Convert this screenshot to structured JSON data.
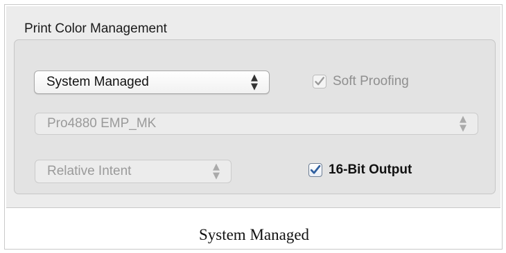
{
  "panel": {
    "title": "Print Color Management"
  },
  "controls": {
    "profile_mode_popup": {
      "selected": "System Managed",
      "icon": "updown-arrows-icon"
    },
    "soft_proofing": {
      "label": "Soft Proofing",
      "checked": true,
      "enabled": false,
      "icon": "checkmark-icon"
    },
    "printer_profile_popup": {
      "selected": "Pro4880 EMP_MK",
      "enabled": false,
      "icon": "updown-arrows-icon"
    },
    "rendering_intent_popup": {
      "selected": "Relative Intent",
      "enabled": false,
      "icon": "updown-arrows-icon"
    },
    "bit16_output": {
      "label": "16-Bit Output",
      "checked": true,
      "enabled": true,
      "icon": "checkmark-icon"
    }
  },
  "caption": {
    "text": "System Managed"
  },
  "colors": {
    "panel_bg": "#ececec",
    "group_bg": "#e3e3e3",
    "check_blue": "#2f5f9f",
    "disabled_text": "#9a9a9a"
  }
}
